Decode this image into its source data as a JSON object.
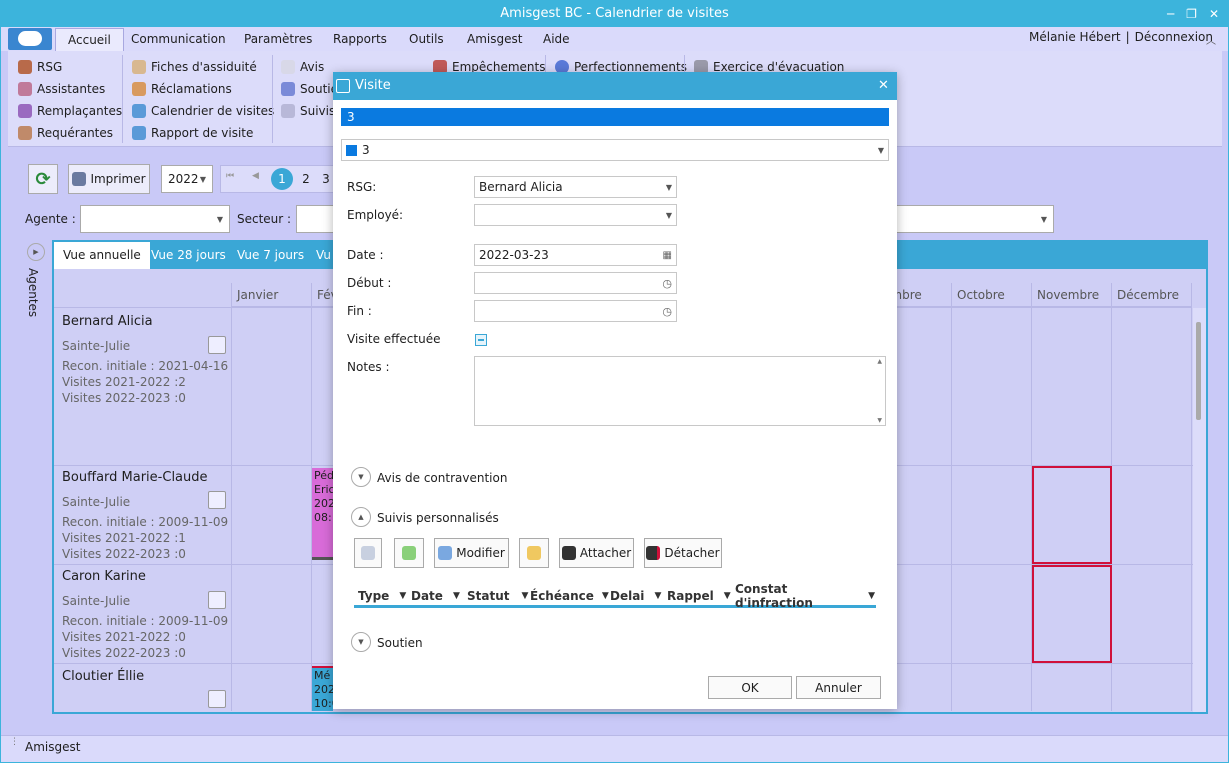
{
  "window": {
    "title": "Amisgest BC - Calendrier de visites",
    "min": "─",
    "max": "❐",
    "close": "✕"
  },
  "menu": {
    "tabs": [
      "Accueil",
      "Communication",
      "Paramètres",
      "Rapports",
      "Outils",
      "Amisgest",
      "Aide"
    ],
    "user": "Mélanie Hébert",
    "sep": "|",
    "logout": "Déconnexion"
  },
  "ribbon": {
    "col1": [
      "RSG",
      "Assistantes",
      "Remplaçantes",
      "Requérantes"
    ],
    "col2": [
      "Fiches d'assiduité",
      "Réclamations",
      "Calendrier de visites",
      "Rapport de visite"
    ],
    "col3": [
      "Avis",
      "Soutien",
      "Suivis"
    ],
    "col4": "Empêchements",
    "col5": "Perfectionnements",
    "col6": "Exercice d'évacuation"
  },
  "toolbar": {
    "print_label": "Imprimer",
    "year": "2022",
    "pages": [
      "1",
      "2",
      "3"
    ],
    "agente_label": "Agente :",
    "secteur_label": "Secteur :"
  },
  "side": {
    "agentes": "Agentes"
  },
  "views": [
    "Vue annuelle",
    "Vue 28 jours",
    "Vue 7 jours",
    "Vu"
  ],
  "months_left": [
    "Janvier",
    "Févr"
  ],
  "months_right": [
    "otembre",
    "Octobre",
    "Novembre",
    "Décembre"
  ],
  "persons": [
    {
      "name": "Bernard Alicia",
      "city": "Sainte-Julie",
      "recon": "Recon. initiale : 2021-04-16",
      "v1": "Visites 2021-2022 :2",
      "v2": "Visites 2022-2023 :0"
    },
    {
      "name": "Bouffard Marie-Claude",
      "city": "Sainte-Julie",
      "recon": "Recon. initiale : 2009-11-09",
      "v1": "Visites 2021-2022 :1",
      "v2": "Visites 2022-2023 :0"
    },
    {
      "name": "Caron Karine",
      "city": "Sainte-Julie",
      "recon": "Recon. initiale : 2009-11-09",
      "v1": "Visites 2021-2022 :0",
      "v2": "Visites 2022-2023 :0"
    },
    {
      "name": "Cloutier Éllie"
    }
  ],
  "events": {
    "e1": [
      "Péd",
      "Eric",
      "202",
      "08:"
    ],
    "e2": [
      "Mé",
      "202",
      "10:0"
    ]
  },
  "dialog": {
    "title": "Visite",
    "header_value": "3",
    "select_value": "3",
    "rsg_label": "RSG:",
    "rsg_value": "Bernard Alicia",
    "employe_label": "Employé:",
    "date_label": "Date :",
    "date_value": "2022-03-23",
    "debut_label": "Début :",
    "fin_label": "Fin :",
    "effectuee_label": "Visite effectuée",
    "notes_label": "Notes :",
    "sec_avis": "Avis de contravention",
    "sec_suivis": "Suivis personnalisés",
    "sec_soutien": "Soutien",
    "btn_modifier": "Modifier",
    "btn_attacher": "Attacher",
    "btn_detacher": "Détacher",
    "cols": [
      "Type",
      "Date",
      "Statut",
      "Échéance",
      "Delai",
      "Rappel",
      "Constat d'infraction"
    ],
    "ok": "OK",
    "cancel": "Annuler"
  },
  "status": {
    "text": "Amisgest"
  },
  "colors": {
    "accent": "#3aa7d6",
    "bg": "#c9c9f7",
    "event1": "#d86bd8",
    "event2": "#3aa7d6",
    "highlight": "#d0103a"
  }
}
